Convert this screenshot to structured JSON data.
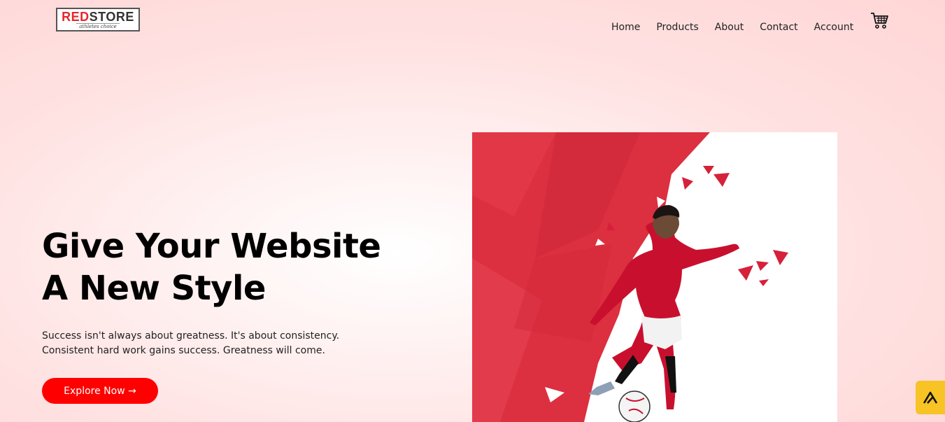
{
  "logo": {
    "brand_red": "RED",
    "brand_dark": "STORE",
    "tagline": "athletes choice"
  },
  "nav": {
    "items": [
      {
        "label": "Home"
      },
      {
        "label": "Products"
      },
      {
        "label": "About"
      },
      {
        "label": "Contact"
      },
      {
        "label": "Account"
      }
    ],
    "cart_icon": "cart-icon"
  },
  "hero": {
    "title_line1": "Give Your Website",
    "title_line2": "A New Style",
    "text": "Success isn't always about greatness. It's about consistency. Consistent hard work gains success. Greatness will come.",
    "button_label": "Explore Now →",
    "image_icon": "footballer-image"
  },
  "badge": {
    "icon": "widget-logo-icon"
  },
  "colors": {
    "accent": "#ff0000",
    "badge": "#f7c325",
    "bg_pink": "#ffd6d6"
  }
}
